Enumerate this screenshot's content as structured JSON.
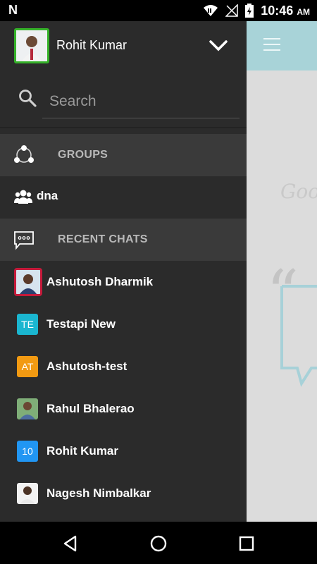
{
  "status_bar": {
    "left_icon": "n-icon",
    "time_main": "10:46",
    "time_suffix": "AM",
    "icons": [
      "wifi-icon",
      "signal-icon",
      "battery-icon"
    ]
  },
  "drawer": {
    "user": {
      "name": "Rohit  Kumar",
      "avatar": "user-photo"
    },
    "search": {
      "placeholder": "Search",
      "value": ""
    },
    "groups_section": {
      "label": "GROUPS",
      "icon": "groups-network-icon"
    },
    "groups": [
      {
        "name": "dna",
        "icon": "people-icon"
      }
    ],
    "recent_section": {
      "label": "RECENT CHATS",
      "icon": "chat-bubble-icon"
    },
    "recent_chats": [
      {
        "name": "Ashutosh  Dharmik",
        "avatar_type": "photo",
        "selected": true
      },
      {
        "name": "Testapi New",
        "avatar_type": "initials",
        "initials": "TE",
        "color": "#1ab6d0"
      },
      {
        "name": "Ashutosh-test",
        "avatar_type": "initials",
        "initials": "AT",
        "color": "#f29a12"
      },
      {
        "name": "Rahul  Bhalerao",
        "avatar_type": "photo"
      },
      {
        "name": "Rohit  Kumar",
        "avatar_type": "initials",
        "initials": "10",
        "color": "#2196f3"
      },
      {
        "name": "Nagesh  Nimbalkar",
        "avatar_type": "photo"
      }
    ]
  },
  "colors": {
    "drawer_bg": "#2b2b2b",
    "section_bg": "#3a3a3a",
    "toolbar_bg": "#a8d3d8",
    "user_avatar_border": "#35b129",
    "selected_avatar_border": "#c41a3a"
  },
  "navbar": {
    "icons": [
      "back-icon",
      "home-icon",
      "recents-icon"
    ]
  }
}
